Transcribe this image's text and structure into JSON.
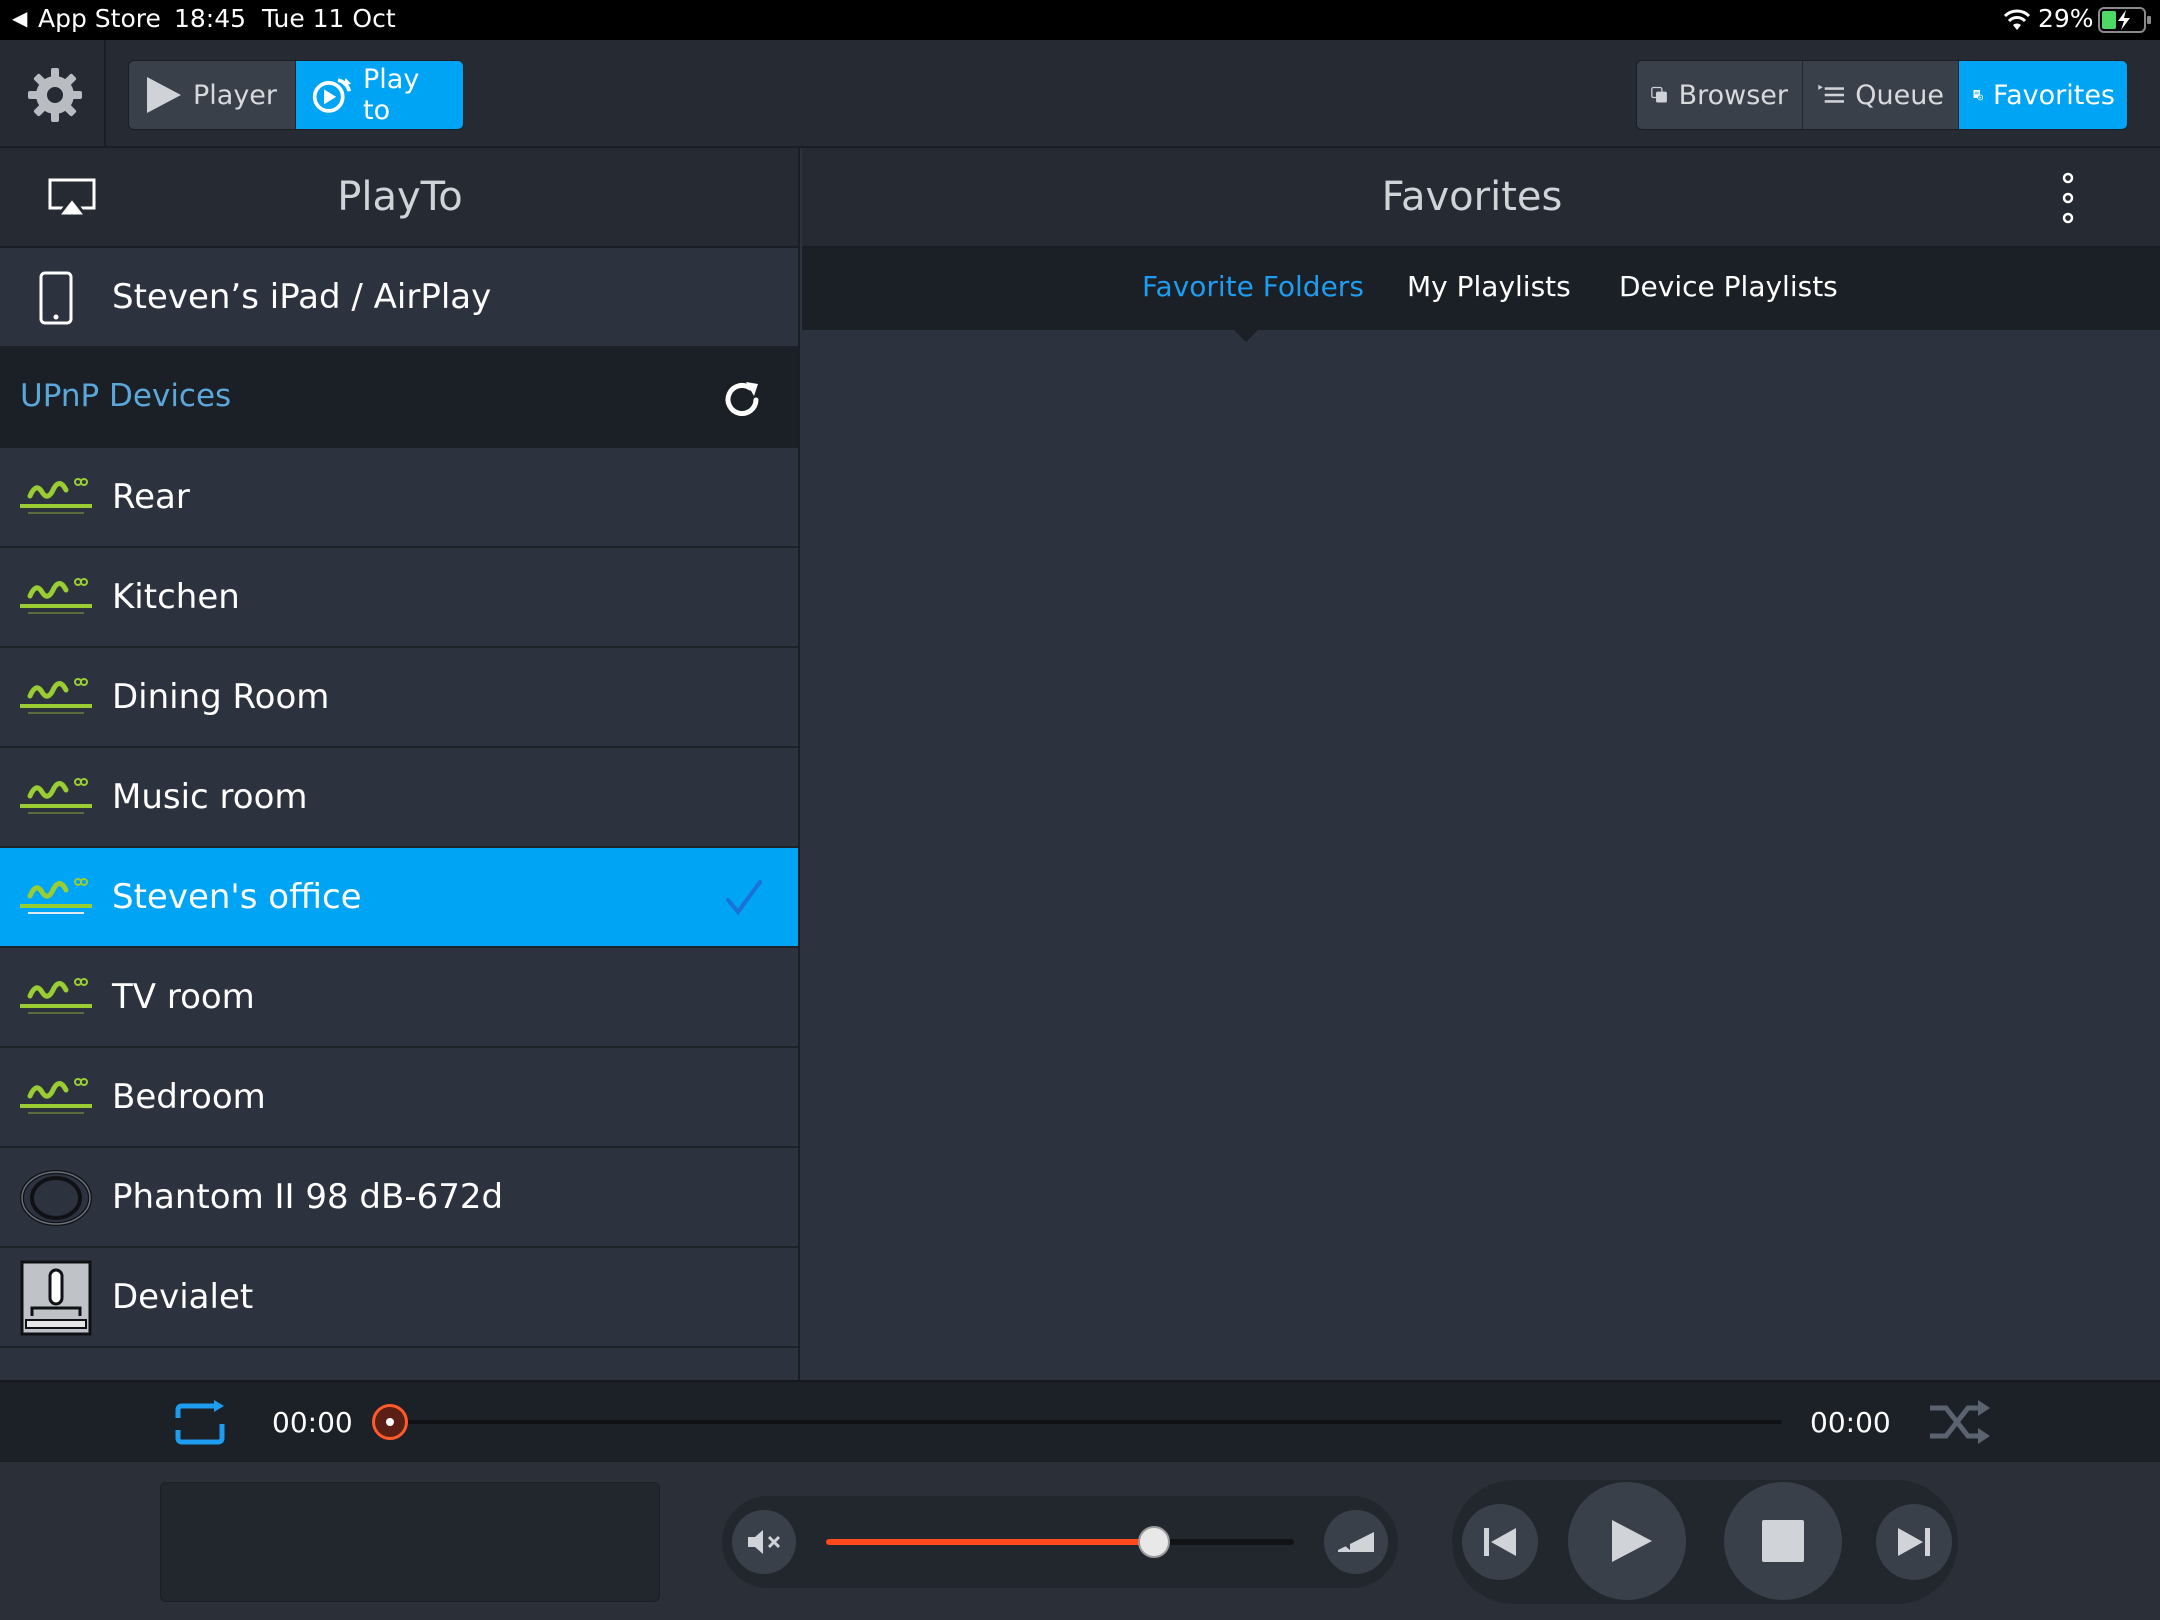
{
  "status_bar": {
    "back_app": "App Store",
    "time": "18:45",
    "date": "Tue 11 Oct",
    "battery": "29%"
  },
  "toolbar": {
    "settings_icon": "gear-icon",
    "player_label": "Player",
    "playto_label": "Play to",
    "browser_label": "Browser",
    "queue_label": "Queue",
    "favorites_label": "Favorites",
    "accent": "#00a4f4"
  },
  "left_panel": {
    "title": "PlayTo",
    "local_device": "Steven’s iPad / AirPlay",
    "section_label": "UPnP Devices",
    "devices": [
      {
        "label": "Rear",
        "icon": "streamunlimited-logo"
      },
      {
        "label": "Kitchen",
        "icon": "streamunlimited-logo"
      },
      {
        "label": "Dining Room",
        "icon": "streamunlimited-logo"
      },
      {
        "label": "Music room",
        "icon": "streamunlimited-logo"
      },
      {
        "label": "Steven's office",
        "icon": "streamunlimited-logo",
        "selected": true
      },
      {
        "label": "TV room",
        "icon": "streamunlimited-logo"
      },
      {
        "label": "Bedroom",
        "icon": "streamunlimited-logo"
      },
      {
        "label": "Phantom II 98 dB-672d",
        "icon": "phantom-speaker-icon"
      },
      {
        "label": "Devialet",
        "icon": "devialet-device-icon"
      }
    ]
  },
  "right_panel": {
    "title": "Favorites",
    "tabs": [
      {
        "label": "Favorite Folders",
        "active": true
      },
      {
        "label": "My Playlists",
        "active": false
      },
      {
        "label": "Device Playlists",
        "active": false
      }
    ]
  },
  "playback": {
    "elapsed": "00:00",
    "duration": "00:00",
    "position_fraction": 0,
    "volume_fraction": 0.7
  }
}
